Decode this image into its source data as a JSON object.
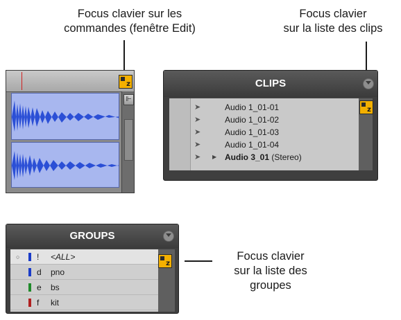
{
  "callouts": {
    "edit_focus": [
      "Focus clavier sur les",
      "commandes (fenêtre Edit)"
    ],
    "clips_focus": [
      "Focus clavier",
      "sur la liste des clips"
    ],
    "groups_focus": [
      "Focus clavier",
      "sur la liste des",
      "groupes"
    ]
  },
  "focus_badge": {
    "label": "z",
    "color": "#f4b000"
  },
  "clips": {
    "title": "CLIPS",
    "menu_icon": "chevron-down-icon",
    "items": [
      {
        "name": "Audio 1_01-01",
        "suffix": ""
      },
      {
        "name": "Audio 1_01-02",
        "suffix": ""
      },
      {
        "name": "Audio 1_01-03",
        "suffix": ""
      },
      {
        "name": "Audio 1_01-04",
        "suffix": ""
      },
      {
        "name": "Audio 3_01",
        "suffix": " (Stereo)"
      }
    ]
  },
  "groups": {
    "title": "GROUPS",
    "menu_icon": "chevron-down-icon",
    "rows": [
      {
        "key": "!",
        "name": "<ALL>",
        "color": "#1a3cc8",
        "selected": true
      },
      {
        "key": "d",
        "name": "pno",
        "color": "#1a3cc8",
        "selected": false
      },
      {
        "key": "e",
        "name": "bs",
        "color": "#1f8a2a",
        "selected": false
      },
      {
        "key": "f",
        "name": "kit",
        "color": "#b02020",
        "selected": false
      }
    ]
  },
  "colors": {
    "waveform": "#2b4fd6",
    "clip_bg": "#a8b7ef",
    "panel": "#3f3f3f"
  }
}
